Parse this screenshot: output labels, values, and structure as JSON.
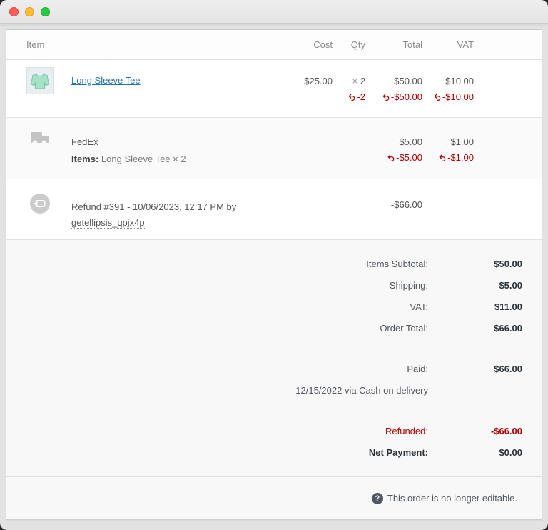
{
  "colors": {
    "accent_link": "#2271b1",
    "refund_red": "#aa0000"
  },
  "table": {
    "headers": {
      "item": "Item",
      "cost": "Cost",
      "qty": "Qty",
      "total": "Total",
      "vat": "VAT"
    }
  },
  "line_items": {
    "product": {
      "name": "Long Sleeve Tee",
      "thumbnail": "long-sleeve-tee-illustration",
      "cost": "$25.00",
      "qty_times": "×",
      "qty": "2",
      "total": "$50.00",
      "vat": "$10.00",
      "refund_qty": "-2",
      "refund_total": "-$50.00",
      "refund_vat": "-$10.00"
    },
    "shipping": {
      "method": "FedEx",
      "items_label": "Items:",
      "items_value": " Long Sleeve Tee × 2",
      "total": "$5.00",
      "vat": "$1.00",
      "refund_total": "-$5.00",
      "refund_vat": "-$1.00"
    },
    "refund": {
      "description": "Refund #391 - 10/06/2023, 12:17 PM by ",
      "by_user": "getellipsis_qpjx4p",
      "total": "-$66.00"
    }
  },
  "totals": {
    "rows": [
      {
        "label": "Items Subtotal:",
        "value": "$50.00"
      },
      {
        "label": "Shipping:",
        "value": "$5.00"
      },
      {
        "label": "VAT:",
        "value": "$11.00"
      },
      {
        "label": "Order Total:",
        "value": "$66.00"
      }
    ],
    "paid": {
      "label": "Paid:",
      "value": "$66.00"
    },
    "paid_note": "12/15/2022 via Cash on delivery",
    "refunded": {
      "label": "Refunded:",
      "value": "-$66.00"
    },
    "net": {
      "label": "Net Payment:",
      "value": "$0.00"
    }
  },
  "footer": {
    "help_glyph": "?",
    "message": "This order is no longer editable."
  }
}
